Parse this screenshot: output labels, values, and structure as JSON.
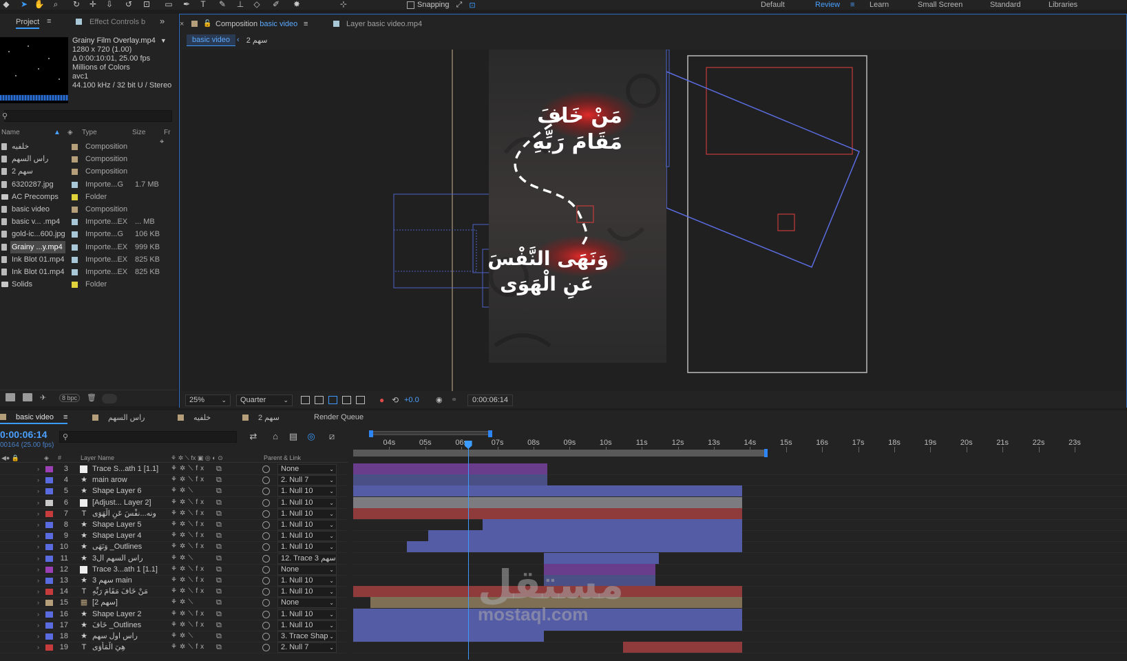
{
  "toolbar": {
    "snapping_label": "Snapping",
    "workspaces": [
      {
        "label": "Default",
        "active": false
      },
      {
        "label": "Review",
        "active": true
      },
      {
        "label": "Learn",
        "active": false
      },
      {
        "label": "Small Screen",
        "active": false
      },
      {
        "label": "Standard",
        "active": false
      },
      {
        "label": "Libraries",
        "active": false
      }
    ]
  },
  "project_panel": {
    "tab_project": "Project",
    "tab_effect_controls": "Effect Controls b",
    "footage_info": {
      "name": "Grainy Film Overlay.mp4",
      "dimensions": "1280 x 720 (1.00)",
      "duration": "Δ 0:00:10:01, 25.00 fps",
      "colors": "Millions of Colors",
      "codec": "avc1",
      "audio": "44.100 kHz / 32 bit U / Stereo"
    },
    "columns": {
      "name": "Name",
      "type": "Type",
      "size": "Size",
      "frame": "Fr"
    },
    "items": [
      {
        "name": "خلفيه",
        "type": "Composition",
        "size": "",
        "label_color": "#b59f7a",
        "kind": "comp",
        "selected": false
      },
      {
        "name": "راس السهم",
        "type": "Composition",
        "size": "",
        "label_color": "#b59f7a",
        "kind": "comp",
        "selected": false
      },
      {
        "name": "سهم 2",
        "type": "Composition",
        "size": "",
        "label_color": "#b59f7a",
        "kind": "comp",
        "selected": false
      },
      {
        "name": "6320287.jpg",
        "type": "Importe...G",
        "size": "1.7 MB",
        "label_color": "#a8c8d8",
        "kind": "file",
        "selected": false
      },
      {
        "name": "AC Precomps",
        "type": "Folder",
        "size": "",
        "label_color": "#e0d23a",
        "kind": "folder",
        "selected": false
      },
      {
        "name": "basic video",
        "type": "Composition",
        "size": "",
        "label_color": "#b59f7a",
        "kind": "comp",
        "selected": false
      },
      {
        "name": "basic v... .mp4",
        "type": "Importe...EX",
        "size": "... MB",
        "label_color": "#a8c8d8",
        "kind": "file",
        "selected": false
      },
      {
        "name": "gold-ic...600.jpg",
        "type": "Importe...G",
        "size": "106 KB",
        "label_color": "#a8c8d8",
        "kind": "file",
        "selected": false
      },
      {
        "name": "Grainy ...y.mp4",
        "type": "Importe...EX",
        "size": "999 KB",
        "label_color": "#a8c8d8",
        "kind": "file",
        "selected": true
      },
      {
        "name": "Ink Blot 01.mp4",
        "type": "Importe...EX",
        "size": "825 KB",
        "label_color": "#a8c8d8",
        "kind": "file",
        "selected": false
      },
      {
        "name": "Ink Blot 01.mp4",
        "type": "Importe...EX",
        "size": "825 KB",
        "label_color": "#a8c8d8",
        "kind": "file",
        "selected": false
      },
      {
        "name": "Solids",
        "type": "Folder",
        "size": "",
        "label_color": "#e0d23a",
        "kind": "folder",
        "selected": false
      }
    ],
    "bpc_label": "8 bpc"
  },
  "composition_panel": {
    "tab_comp_prefix": "Composition",
    "tab_comp_name": "basic video",
    "tab_layer": "Layer  basic video.mp4",
    "breadcrumb_active": "basic video",
    "breadcrumb_next": "سهم 2",
    "text_top_line1": "مَنْ خَافَ",
    "text_top_line2": "مَقَامَ رَبِّهِ",
    "text_bottom_line1": "وَنَهَى النَّفْسَ",
    "text_bottom_line2": "عَنِ الْهَوَى",
    "zoom": "25%",
    "resolution": "Quarter",
    "exposure": "+0.0",
    "current_time": "0:00:06:14"
  },
  "timeline_panel": {
    "tabs": [
      {
        "label": "basic video",
        "color": "#b59f7a",
        "active": true
      },
      {
        "label": "راس السهم",
        "color": "#b59f7a",
        "active": false
      },
      {
        "label": "خلفيه",
        "color": "#b59f7a",
        "active": false
      },
      {
        "label": "سهم 2",
        "color": "#b59f7a",
        "active": false
      },
      {
        "label": "Render Queue",
        "color": "",
        "active": false
      }
    ],
    "timecode": "0:00:06:14",
    "fps": "00164 (25.00 fps)",
    "header": {
      "hash": "#",
      "layer_name": "Layer Name",
      "parent_link": "Parent & Link"
    },
    "ruler_labels": [
      "04s",
      "05s",
      "06s",
      "07s",
      "08s",
      "09s",
      "10s",
      "11s",
      "12s",
      "13s",
      "14s",
      "15s",
      "16s",
      "17s",
      "18s",
      "19s",
      "20s",
      "21s",
      "22s",
      "23s"
    ],
    "current_time_seconds": 6.6,
    "layers": [
      {
        "num": "3",
        "type": "box",
        "name": "Trace S...ath 1 [1.1]",
        "color": "#9b3fb5",
        "parent": "None",
        "fx": true,
        "bar_start": 3.0,
        "bar_end": 8.8,
        "bar_color": "#6a3d8c"
      },
      {
        "num": "4",
        "type": "star",
        "name": "main arow",
        "color": "#5a6adf",
        "parent": "2. Null 7",
        "fx": true,
        "bar_start": 3.0,
        "bar_end": 8.8,
        "bar_color": "#4a4f86"
      },
      {
        "num": "5",
        "type": "star",
        "name": "Shape Layer 6",
        "color": "#5a6adf",
        "parent": "1. Null 10",
        "fx": false,
        "bar_start": 3.0,
        "bar_end": 14.2,
        "bar_color": "#555ca6"
      },
      {
        "num": "6",
        "type": "box",
        "name": "[Adjust... Layer 2]",
        "color": "#c9c9c9",
        "parent": "1. Null 10",
        "fx": true,
        "bar_start": 3.0,
        "bar_end": 14.2,
        "bar_color": "#7b7b80"
      },
      {
        "num": "7",
        "type": "T",
        "name": "ونه...نفْسَ عَنِ الْهَوَى",
        "color": "#c63c3c",
        "parent": "1. Null 10",
        "fx": true,
        "bar_start": 3.0,
        "bar_end": 14.2,
        "bar_color": "#8f3b3b"
      },
      {
        "num": "8",
        "type": "star",
        "name": "Shape Layer 5",
        "color": "#5a6adf",
        "parent": "1. Null 10",
        "fx": true,
        "bar_start": 7.0,
        "bar_end": 14.2,
        "bar_color": "#555ca6"
      },
      {
        "num": "9",
        "type": "star",
        "name": "Shape Layer 4",
        "color": "#5a6adf",
        "parent": "1. Null 10",
        "fx": true,
        "bar_start": 5.5,
        "bar_end": 14.2,
        "bar_color": "#555ca6"
      },
      {
        "num": "10",
        "type": "star",
        "name": "وَنَهَى _Outlines",
        "color": "#5a6adf",
        "parent": "1. Null 10",
        "fx": true,
        "bar_start": 4.9,
        "bar_end": 14.2,
        "bar_color": "#555ca6"
      },
      {
        "num": "11",
        "type": "star",
        "name": "راس السهم ال3",
        "color": "#5a6adf",
        "parent": "12. Trace 3 سهم",
        "fx": false,
        "bar_start": 8.7,
        "bar_end": 11.9,
        "bar_color": "#555ca6"
      },
      {
        "num": "12",
        "type": "box",
        "name": "Trace 3...ath 1 [1.1]",
        "color": "#9b3fb5",
        "parent": "None",
        "fx": true,
        "bar_start": 8.7,
        "bar_end": 11.8,
        "bar_color": "#6a3d8c"
      },
      {
        "num": "13",
        "type": "star",
        "name": "3 سهم main",
        "color": "#5a6adf",
        "parent": "1. Null 10",
        "fx": true,
        "bar_start": 8.7,
        "bar_end": 11.8,
        "bar_color": "#4a4f86"
      },
      {
        "num": "14",
        "type": "T",
        "name": "مَنْ خَافَ مَقَامَ رَبِّهِ",
        "color": "#c63c3c",
        "parent": "1. Null 10",
        "fx": true,
        "bar_start": 3.0,
        "bar_end": 14.2,
        "bar_color": "#8f3b3b"
      },
      {
        "num": "15",
        "type": "comp",
        "name": "[سهم 2]",
        "color": "#b59f7a",
        "parent": "None",
        "fx": false,
        "bar_start": 3.9,
        "bar_end": 14.2,
        "bar_color": "#7e6f55"
      },
      {
        "num": "16",
        "type": "star",
        "name": "Shape Layer 2",
        "color": "#5a6adf",
        "parent": "1. Null 10",
        "fx": true,
        "bar_start": 3.0,
        "bar_end": 14.2,
        "bar_color": "#555ca6"
      },
      {
        "num": "17",
        "type": "star",
        "name": "خَافَ _Outlines",
        "color": "#5a6adf",
        "parent": "1. Null 10",
        "fx": true,
        "bar_start": 3.0,
        "bar_end": 14.2,
        "bar_color": "#555ca6"
      },
      {
        "num": "18",
        "type": "star",
        "name": "راس اول سهم",
        "color": "#5a6adf",
        "parent": "3. Trace Shap",
        "fx": false,
        "bar_start": 3.0,
        "bar_end": 8.7,
        "bar_color": "#555ca6"
      },
      {
        "num": "19",
        "type": "T",
        "name": "هِيَ الْمَأْوَى",
        "color": "#c63c3c",
        "parent": "2. Null 7",
        "fx": true,
        "bar_start": 10.9,
        "bar_end": 14.2,
        "bar_color": "#8f3b3b"
      }
    ]
  },
  "watermark": {
    "arabic": "مستقل",
    "latin": "mostaql.com"
  }
}
